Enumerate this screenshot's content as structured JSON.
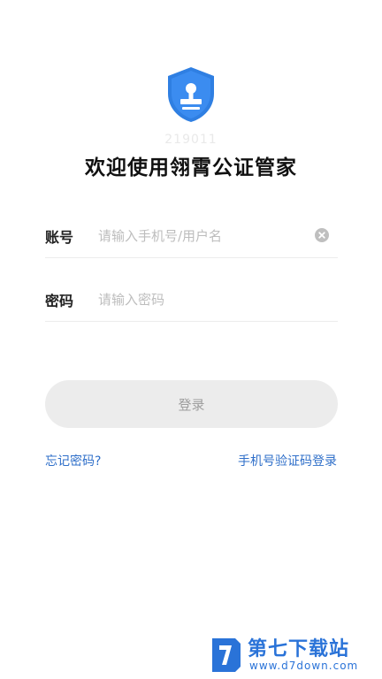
{
  "app": {
    "version_code": "219011",
    "title": "欢迎使用翎霄公证管家"
  },
  "form": {
    "account": {
      "label": "账号",
      "placeholder": "请输入手机号/用户名",
      "value": ""
    },
    "password": {
      "label": "密码",
      "placeholder": "请输入密码",
      "value": ""
    },
    "login_label": "登录",
    "forgot_label": "忘记密码?",
    "sms_login_label": "手机号验证码登录"
  },
  "watermark": {
    "name": "第七下载站",
    "url": "www.d7down.com"
  },
  "colors": {
    "accent": "#2f6fc9",
    "logo_blue": "#2f7fe2",
    "button_bg": "#ececec",
    "button_text": "#9e9e9e"
  },
  "icons": {
    "logo": "notary-shield-stamp-icon",
    "clear": "clear-circle-icon"
  }
}
